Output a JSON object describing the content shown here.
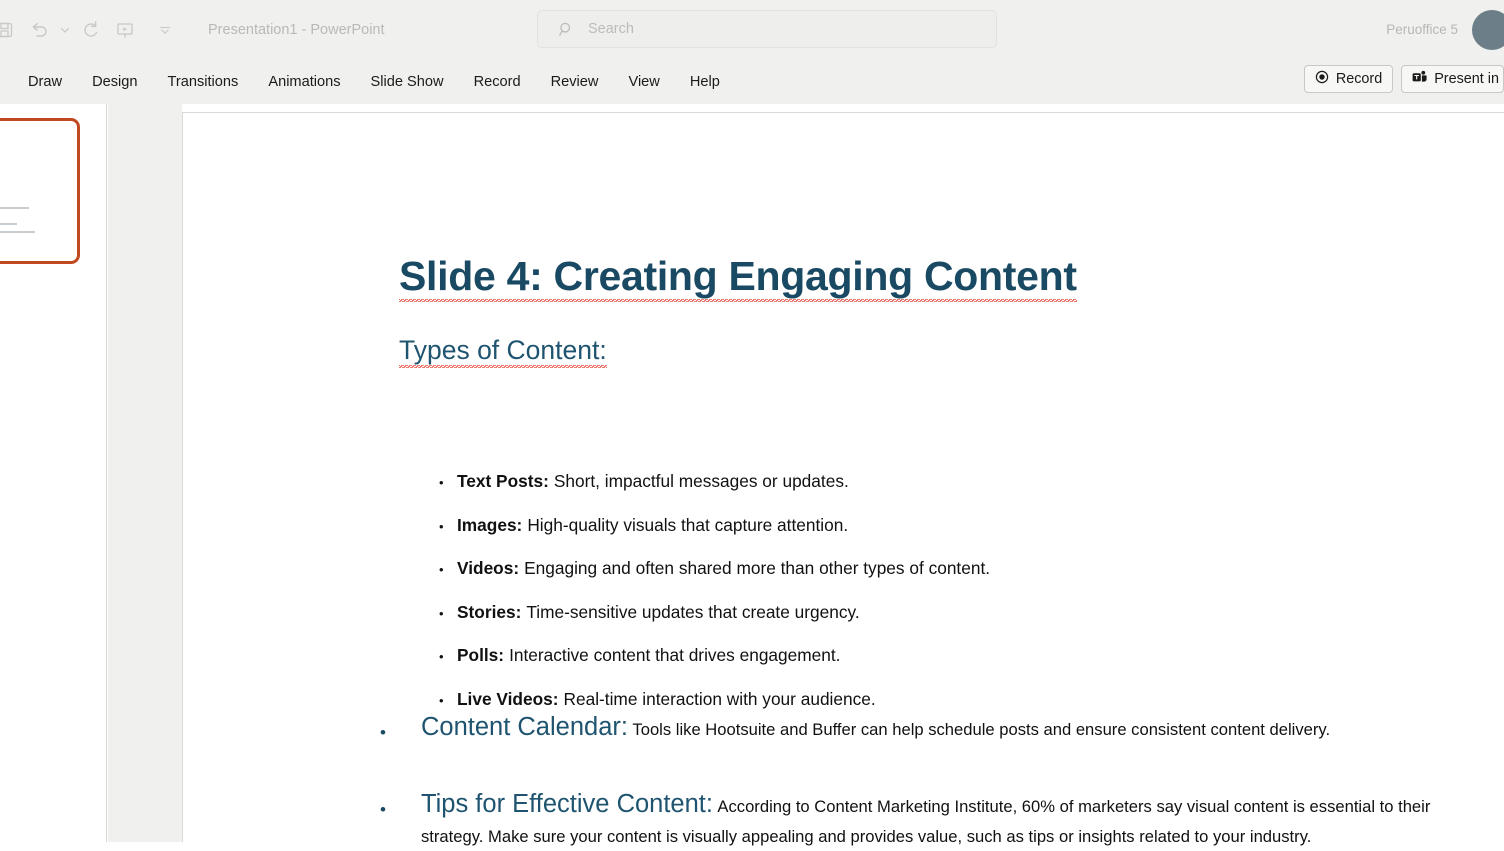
{
  "titlebar": {
    "document_title": "Presentation1  -  PowerPoint",
    "account_name": "Peruoffice 5",
    "qat": [
      {
        "name": "save-icon",
        "label": "Save"
      },
      {
        "name": "undo-icon",
        "label": "Undo"
      },
      {
        "name": "undo-dropdown-icon",
        "label": "Undo options"
      },
      {
        "name": "redo-icon",
        "label": "Redo"
      },
      {
        "name": "start-presentation-icon",
        "label": "Start from Beginning"
      },
      {
        "name": "customize-qat-icon",
        "label": "Customize Quick Access Toolbar"
      }
    ]
  },
  "search": {
    "placeholder": "Search",
    "icon": "search-icon"
  },
  "ribbon": {
    "tabs": [
      {
        "label": "Draw"
      },
      {
        "label": "Design"
      },
      {
        "label": "Transitions"
      },
      {
        "label": "Animations"
      },
      {
        "label": "Slide Show"
      },
      {
        "label": "Record"
      },
      {
        "label": "Review"
      },
      {
        "label": "View"
      },
      {
        "label": "Help"
      }
    ],
    "record_button": {
      "label": "Record",
      "icon": "record-circle-icon"
    },
    "present_button": {
      "label": "Present in",
      "icon": "teams-icon"
    }
  },
  "thumbnail_pane": {
    "selected_slide_border_color": "#c0491f"
  },
  "slide": {
    "title": "Slide 4: Creating Engaging Content",
    "subheading": "Types of Content:",
    "title_color": "#1a4a63",
    "accent_color": "#1f5470",
    "content_types": [
      {
        "label": "Text Posts:",
        "text": "Short, impactful messages or updates."
      },
      {
        "label": "Images:",
        "text": "High-quality visuals that capture attention."
      },
      {
        "label": "Videos:",
        "text": "Engaging and often shared more than other types of content."
      },
      {
        "label": "Stories:",
        "text": "Time-sensitive updates that create urgency."
      },
      {
        "label": "Polls:",
        "text": "Interactive content that drives engagement."
      },
      {
        "label": "Live Videos:",
        "text": "Real-time interaction with your audience."
      }
    ],
    "sections": [
      {
        "heading": "Content Calendar:",
        "body": "Tools like Hootsuite and Buffer can help schedule posts and ensure consistent content delivery."
      },
      {
        "heading": "Tips for Effective Content:",
        "body": "According to Content Marketing Institute, 60% of marketers say visual content is essential to their strategy. Make sure your content is visually appealing and provides value, such as tips or insights related to your industry."
      }
    ]
  }
}
